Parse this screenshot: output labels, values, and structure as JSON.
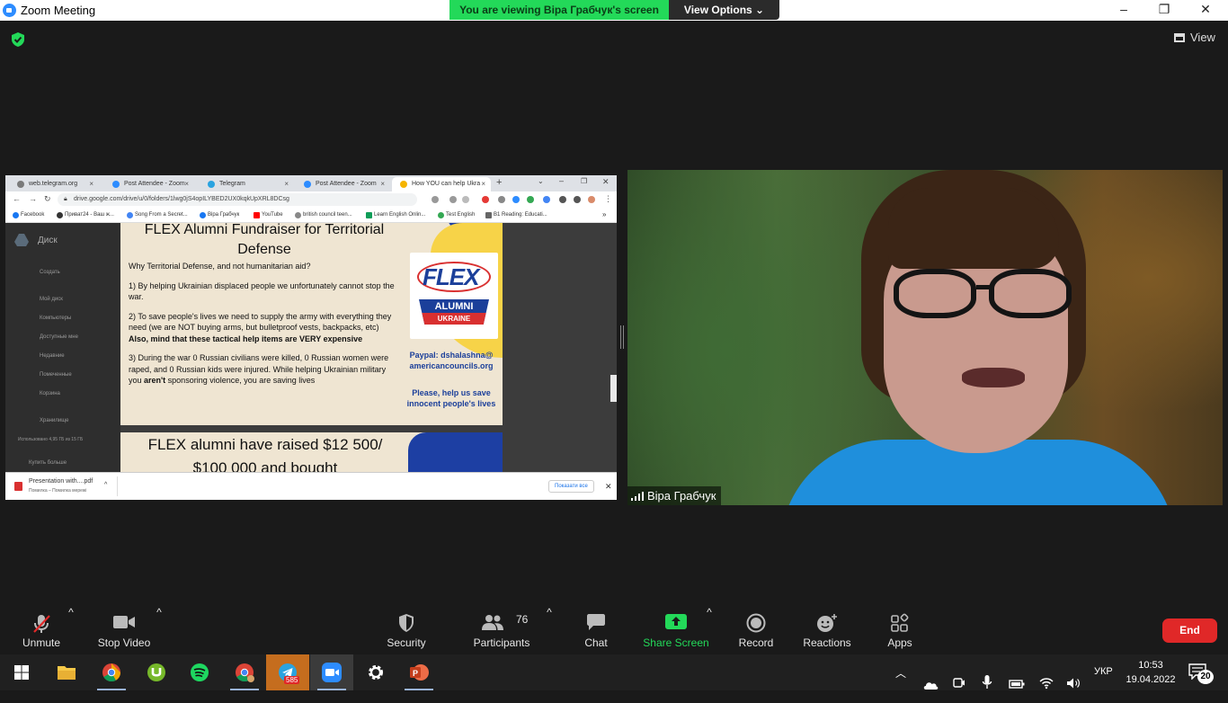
{
  "window": {
    "title": "Zoom Meeting",
    "minimize": "–",
    "maximize": "❐",
    "close": "✕"
  },
  "banner": {
    "viewing_text": "You are viewing Віра Грабчук's screen",
    "view_options": "View Options ⌄"
  },
  "top_right": {
    "view_label": "View"
  },
  "shared_screen": {
    "tabs": [
      {
        "label": "web.telegram.org",
        "color": "#7a7a7a"
      },
      {
        "label": "Post Attendee - Zoom",
        "color": "#2d8cff"
      },
      {
        "label": "Telegram",
        "color": "#2aa3e0"
      },
      {
        "label": "Post Attendee - Zoom",
        "color": "#2d8cff"
      },
      {
        "label": "How YOU can help Ukra",
        "color": "#f5b400"
      }
    ],
    "new_tab": "+",
    "url": "drive.google.com/drive/u/0/folders/1lwg0jS4opILYBED2UX0kqkUpXRL8DCsg",
    "bookmarks": [
      {
        "label": "Facebook",
        "color": "#1877f2"
      },
      {
        "label": "Приват24 - Ваш ж...",
        "color": "#333333"
      },
      {
        "label": "Song From a Secret...",
        "color": "#4285f4"
      },
      {
        "label": "Віра Грабчук",
        "color": "#1877f2"
      },
      {
        "label": "YouTube",
        "color": "#ff0000"
      },
      {
        "label": "british council teen...",
        "color": "#888888"
      },
      {
        "label": "Learn English Onlin...",
        "color": "#0f9d58"
      },
      {
        "label": "Test English",
        "color": "#34a853"
      },
      {
        "label": "B1 Reading: Educati...",
        "color": "#666666"
      }
    ],
    "drive": {
      "app_name": "Диск",
      "create": "Создать",
      "sidebar": [
        "Мой диск",
        "Компьютеры",
        "Доступные мне",
        "Недавние",
        "Помеченные",
        "Корзина",
        "Хранилище"
      ],
      "storage_text": "Использовано 4,95 ГБ из 15 ГБ",
      "buy_storage": "Купить больше"
    },
    "slide1": {
      "title_line1": "FLEX Alumni Fundraiser for Territorial",
      "title_line2": "Defense",
      "question": "Why Territorial Defense, and not humanitarian aid?",
      "point1": "1) By helping Ukrainian displaced people we unfortunately cannot stop the war.",
      "point2_normal": "2) To save people's lives we need to supply the army with everything they need (we are NOT buying arms, but bulletproof vests,  backpacks, etc) ",
      "point2_bold": "Also, mind that these tactical help items are VERY expensive",
      "point3_a": "3) During the war 0 Russian civilians were killed, 0 Russian women were raped, and 0 Russian kids were injured. While helping  Ukrainian military you ",
      "point3_bold": "aren't",
      "point3_b": " sponsoring violence, you are saving lives",
      "logo_text": "FLEX",
      "logo_alumni": "ALUMNI",
      "logo_ukraine": "UKRAINE",
      "paypal_line1": "Paypal: dshalashna@",
      "paypal_line2": "americancouncils.org",
      "please_line1": "Please, help us save",
      "please_line2": "innocent people's lives"
    },
    "slide2": {
      "line1": "FLEX alumni have raised $12 500/",
      "line2": "$100 000 and bought"
    },
    "download": {
      "name": "Presentation with....pdf",
      "status": "Помилка – Помилка мережі",
      "show_all": "Показати все",
      "close": "✕"
    }
  },
  "video": {
    "participant_name": "Віра Грабчук"
  },
  "toolbar": {
    "unmute": "Unmute",
    "stop_video": "Stop Video",
    "security": "Security",
    "participants": "Participants",
    "participants_count": "76",
    "chat": "Chat",
    "share_screen": "Share Screen",
    "record": "Record",
    "reactions": "Reactions",
    "apps": "Apps",
    "end": "End",
    "caret": "^"
  },
  "taskbar": {
    "telegram_badge": "585",
    "language": "УКР",
    "time": "10:53",
    "date": "19.04.2022",
    "notifications": "20"
  },
  "colors": {
    "banner_green": "#23d959",
    "end_red": "#e02828",
    "share_green": "#23d959",
    "unmute_red": "#e02828"
  }
}
